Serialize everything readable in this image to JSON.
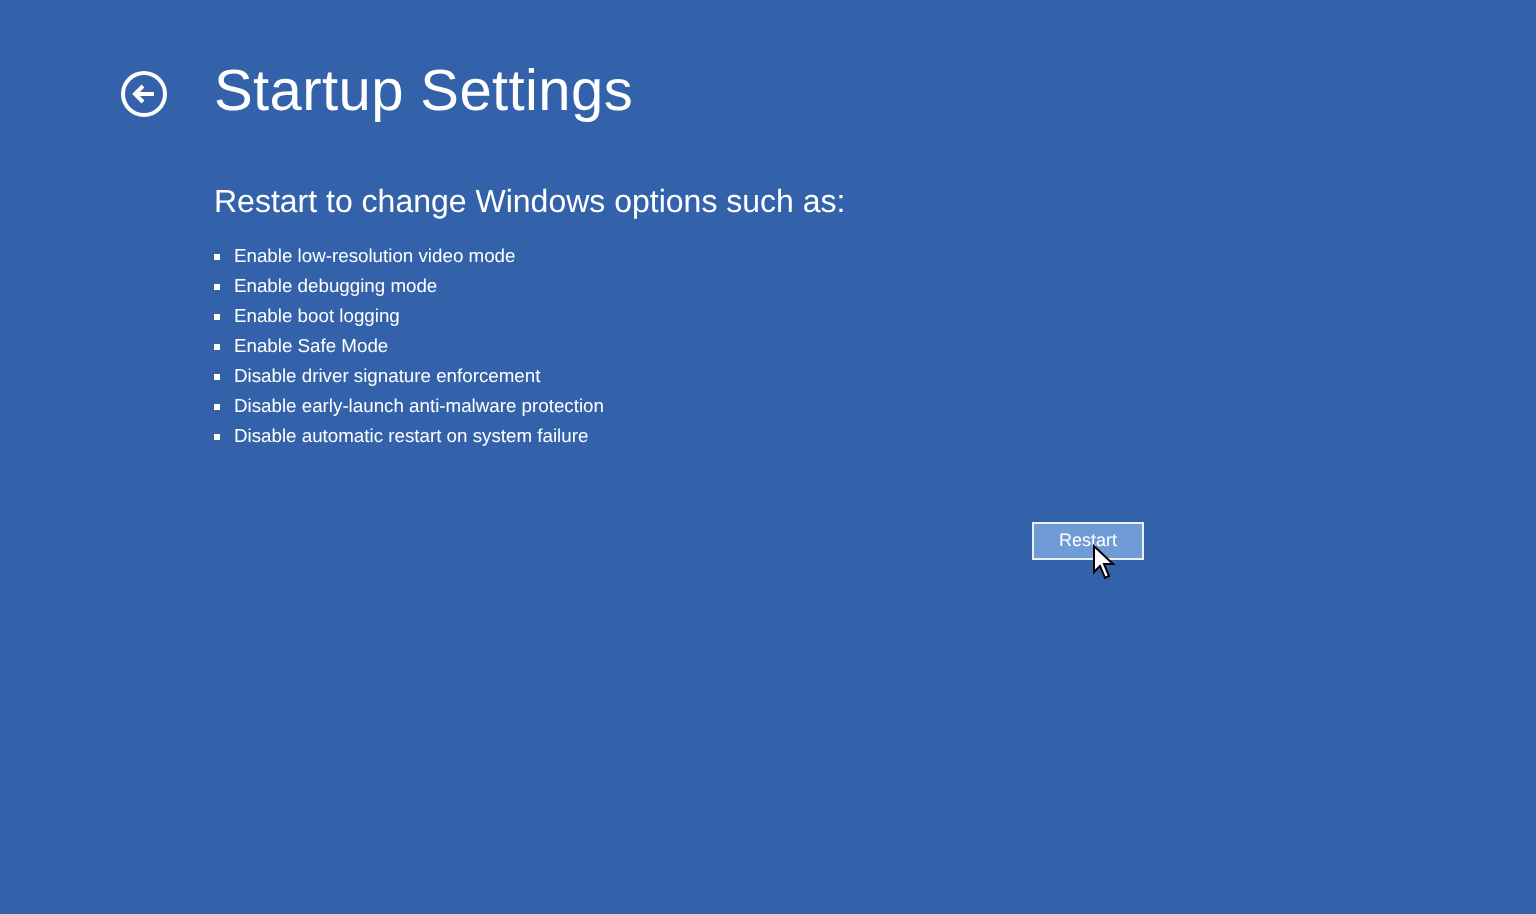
{
  "title": "Startup Settings",
  "subtitle": "Restart to change Windows options such as:",
  "options": [
    "Enable low-resolution video mode",
    "Enable debugging mode",
    "Enable boot logging",
    "Enable Safe Mode",
    "Disable driver signature enforcement",
    "Disable early-launch anti-malware protection",
    "Disable automatic restart on system failure"
  ],
  "button": {
    "label": "Restart"
  }
}
